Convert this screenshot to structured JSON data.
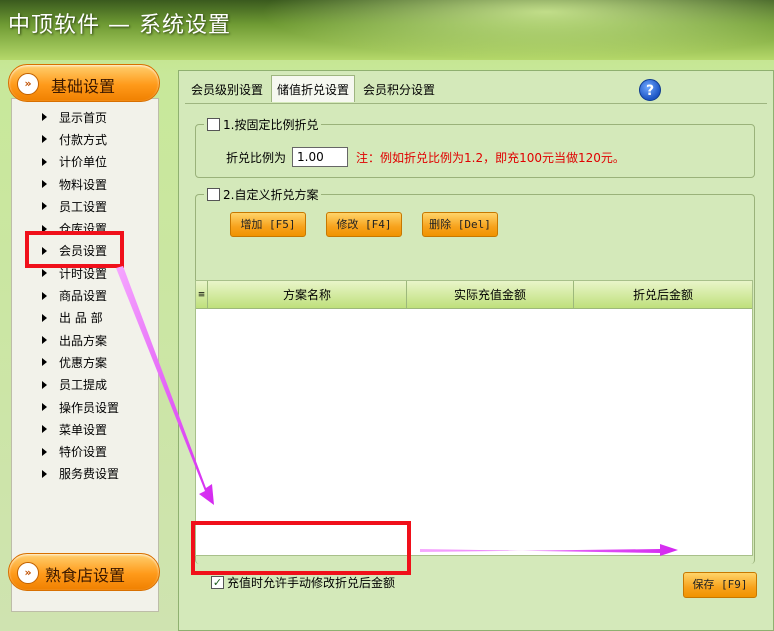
{
  "window": {
    "title": "中顶软件 — 系统设置"
  },
  "sidebar": {
    "group_top": {
      "label": "基础设置",
      "icon": "double-chevron-icon"
    },
    "items": [
      "显示首页",
      "付款方式",
      "计价单位",
      "物料设置",
      "员工设置",
      "仓库设置",
      "会员设置",
      "计时设置",
      "商品设置",
      "出 品 部",
      "出品方案",
      "优惠方案",
      "员工提成",
      "操作员设置",
      "菜单设置",
      "特价设置",
      "服务费设置"
    ],
    "group_bottom": {
      "label": "熟食店设置",
      "icon": "double-chevron-icon"
    },
    "selected": "会员设置"
  },
  "tabs": [
    "会员级别设置",
    "储值折兑设置",
    "会员积分设置"
  ],
  "active_tab": "储值折兑设置",
  "fixed_ratio": {
    "legend": "1.按固定比例折兑",
    "checked": false,
    "label": "折兑比例为",
    "value": "1.00",
    "note": "注：例如折兑比例为1.2，即充100元当做120元。"
  },
  "custom_plan": {
    "legend": "2.自定义折兑方案",
    "checked": false,
    "buttons": {
      "add": "增加 [F5]",
      "edit": "修改 [F4]",
      "delete": "删除 [Del]"
    },
    "columns": [
      "方案名称",
      "实际充值金额",
      "折兑后金额"
    ],
    "rows": []
  },
  "allow_manual": {
    "label": "充值时允许手动修改折兑后金额",
    "checked": true
  },
  "save_label": "保存 [F9]",
  "colors": {
    "accent_orange": "#f7a21c",
    "highlight_red": "#f0101a",
    "arrow_magenta": "#e040f0",
    "note_red": "#e00000"
  }
}
